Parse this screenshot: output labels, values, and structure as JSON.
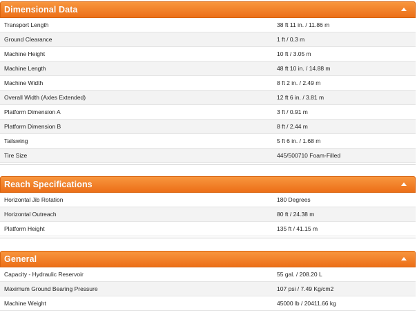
{
  "sections": [
    {
      "title": "Dimensional Data",
      "rows": [
        {
          "label": "Transport Length",
          "value": "38 ft 11 in. / 11.86 m"
        },
        {
          "label": "Ground Clearance",
          "value": "1 ft / 0.3 m"
        },
        {
          "label": "Machine Height",
          "value": "10 ft / 3.05 m"
        },
        {
          "label": "Machine Length",
          "value": "48 ft 10 in. / 14.88 m"
        },
        {
          "label": "Machine Width",
          "value": "8 ft 2 in. / 2.49 m"
        },
        {
          "label": "Overall Width (Axles Extended)",
          "value": "12 ft 6 in. / 3.81 m"
        },
        {
          "label": "Platform Dimension A",
          "value": "3 ft / 0.91 m"
        },
        {
          "label": "Platform Dimension B",
          "value": "8 ft / 2.44 m"
        },
        {
          "label": "Tailswing",
          "value": "5 ft 6 in. / 1.68 m"
        },
        {
          "label": "Tire Size",
          "value": "445/500710 Foam-Filled"
        }
      ]
    },
    {
      "title": "Reach Specifications",
      "rows": [
        {
          "label": "Horizontal Jib Rotation",
          "value": "180 Degrees"
        },
        {
          "label": "Horizontal Outreach",
          "value": "80 ft / 24.38 m"
        },
        {
          "label": "Platform Height",
          "value": "135 ft / 41.15 m"
        }
      ]
    },
    {
      "title": "General",
      "rows": [
        {
          "label": "Capacity - Hydraulic Reservoir",
          "value": "55 gal. / 208.20 L"
        },
        {
          "label": "Maximum Ground Bearing Pressure",
          "value": "107 psi / 7.49 Kg/cm2"
        },
        {
          "label": "Machine Weight",
          "value": "45000 lb / 20411.66 kg"
        }
      ]
    }
  ],
  "colors": {
    "header_top": "#f8963e",
    "header_bottom": "#ec6f18",
    "row_alt": "#f3f3f3"
  }
}
